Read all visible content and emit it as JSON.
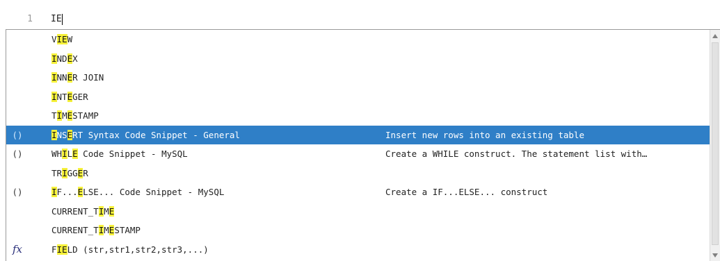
{
  "editor": {
    "line_number": "1",
    "line_text": "IE"
  },
  "autocomplete": {
    "items": [
      {
        "icon": "",
        "pre": "V",
        "hl1": "IE",
        "mid": "W",
        "hl2": "",
        "post": "",
        "desc": ""
      },
      {
        "icon": "",
        "pre": "",
        "hl1": "I",
        "mid": "ND",
        "hl2": "E",
        "post": "X",
        "desc": ""
      },
      {
        "icon": "",
        "pre": "",
        "hl1": "I",
        "mid": "NN",
        "hl2": "E",
        "post": "R JOIN",
        "desc": ""
      },
      {
        "icon": "",
        "pre": "",
        "hl1": "I",
        "mid": "NT",
        "hl2": "E",
        "post": "GER",
        "desc": ""
      },
      {
        "icon": "",
        "pre": "T",
        "hl1": "I",
        "mid": "M",
        "hl2": "E",
        "post": "STAMP",
        "desc": ""
      },
      {
        "icon": "()",
        "pre": "",
        "hl1": "I",
        "mid": "NS",
        "hl2": "E",
        "post": "RT Syntax Code Snippet - General",
        "desc": "Insert new rows into an existing table",
        "selected": true
      },
      {
        "icon": "()",
        "pre": "WH",
        "hl1": "I",
        "mid": "L",
        "hl2": "E",
        "post": " Code Snippet - MySQL",
        "desc": "Create a WHILE construct. The statement list with…"
      },
      {
        "icon": "",
        "pre": "TR",
        "hl1": "I",
        "mid": "GG",
        "hl2": "E",
        "post": "R",
        "desc": ""
      },
      {
        "icon": "()",
        "pre": "",
        "hl1": "I",
        "mid": "F...",
        "hl2": "E",
        "post": "LSE... Code Snippet - MySQL",
        "desc": "Create a IF...ELSE... construct"
      },
      {
        "icon": "",
        "pre": "CURRENT_T",
        "hl1": "I",
        "mid": "M",
        "hl2": "E",
        "post": "",
        "desc": ""
      },
      {
        "icon": "",
        "pre": "CURRENT_T",
        "hl1": "I",
        "mid": "M",
        "hl2": "E",
        "post": "STAMP",
        "desc": ""
      },
      {
        "icon": "fx",
        "pre": "F",
        "hl1": "IE",
        "mid": "",
        "hl2": "",
        "post": "LD (str,str1,str2,str3,...)",
        "desc": ""
      }
    ]
  },
  "colors": {
    "selection": "#2f7fc7",
    "match_highlight": "#f6f13a"
  }
}
